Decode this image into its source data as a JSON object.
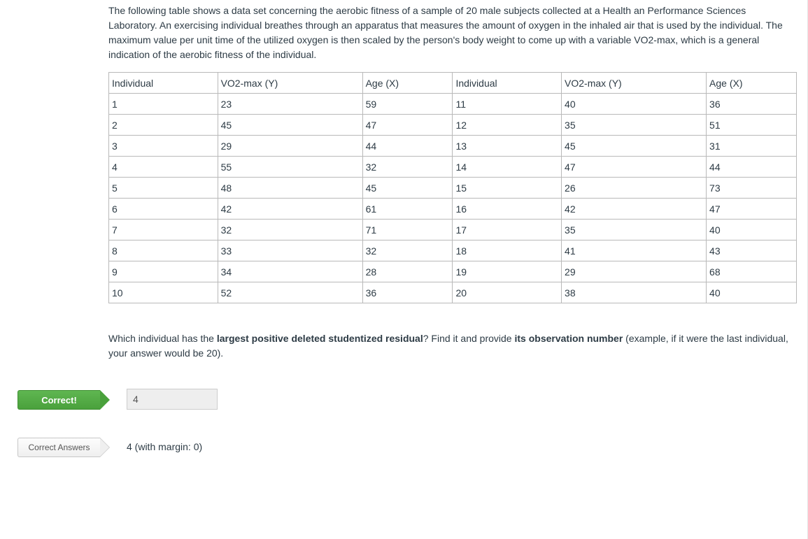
{
  "intro": "The following table shows a data set concerning the aerobic fitness of a sample of 20 male subjects collected at a Health an Performance Sciences Laboratory. An exercising individual breathes through an apparatus that measures the amount of oxygen in the inhaled air that is used by the individual. The maximum value per unit time of the utilized oxygen is then scaled by the person's body weight to come up with a variable VO2-max, which is a general indication of the aerobic fitness of the individual.",
  "headers": {
    "h1": "Individual",
    "h2": "VO2-max (Y)",
    "h3": "Age (X)",
    "h4": "Individual",
    "h5": "VO2-max (Y)",
    "h6": "Age (X)"
  },
  "rows": [
    {
      "a": "1",
      "b": "23",
      "c": "59",
      "d": "11",
      "e": "40",
      "f": "36"
    },
    {
      "a": "2",
      "b": "45",
      "c": "47",
      "d": "12",
      "e": "35",
      "f": "51"
    },
    {
      "a": "3",
      "b": "29",
      "c": "44",
      "d": "13",
      "e": "45",
      "f": "31"
    },
    {
      "a": "4",
      "b": "55",
      "c": "32",
      "d": "14",
      "e": "47",
      "f": "44"
    },
    {
      "a": "5",
      "b": "48",
      "c": "45",
      "d": "15",
      "e": "26",
      "f": "73"
    },
    {
      "a": "6",
      "b": "42",
      "c": "61",
      "d": "16",
      "e": "42",
      "f": "47"
    },
    {
      "a": "7",
      "b": "32",
      "c": "71",
      "d": "17",
      "e": "35",
      "f": "40"
    },
    {
      "a": "8",
      "b": "33",
      "c": "32",
      "d": "18",
      "e": "41",
      "f": "43"
    },
    {
      "a": "9",
      "b": "34",
      "c": "28",
      "d": "19",
      "e": "29",
      "f": "68"
    },
    {
      "a": "10",
      "b": "52",
      "c": "36",
      "d": "20",
      "e": "38",
      "f": "40"
    }
  ],
  "question": {
    "pre": "Which individual has the ",
    "bold1": "largest positive deleted studentized residual",
    "mid": "? Find it and provide ",
    "bold2": "its observation number",
    "post": " (example, if it were the last individual, your answer would be 20)."
  },
  "tags": {
    "correct": "Correct!",
    "correct_answers": "Correct Answers"
  },
  "answer_value": "4",
  "correct_answer_text": "4 (with margin: 0)"
}
